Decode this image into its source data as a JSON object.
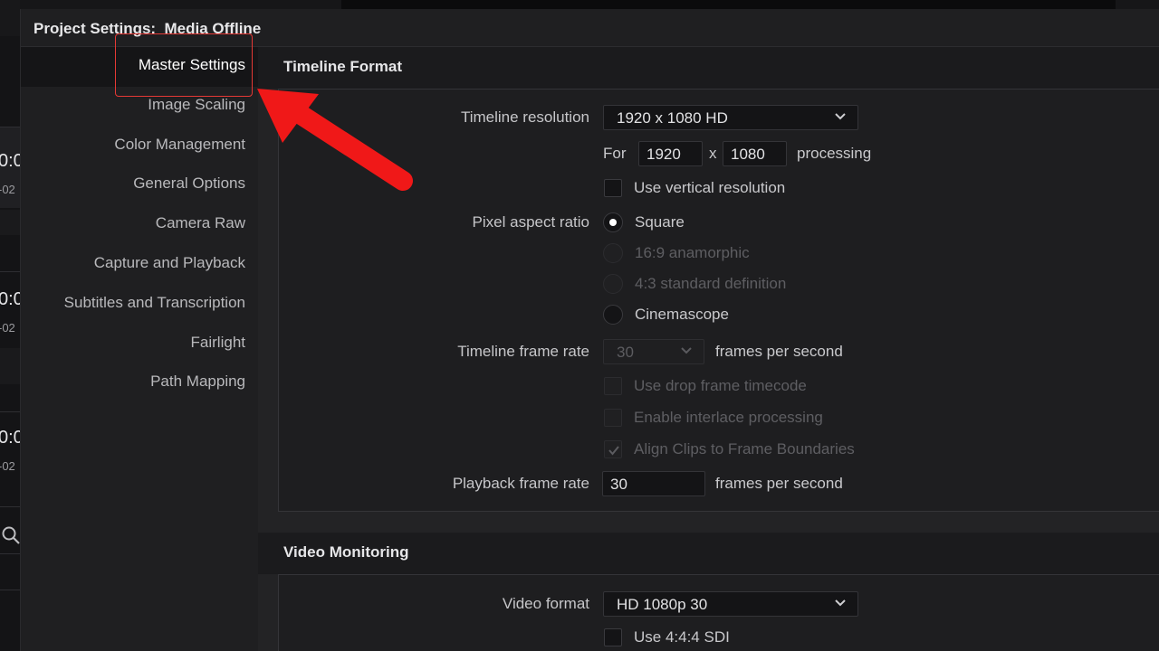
{
  "background": {
    "timecodes": [
      {
        "main": "0:0",
        "sub": "-02"
      },
      {
        "main": "0:0",
        "sub": "-02"
      },
      {
        "main": "0:0",
        "sub": "-02"
      }
    ]
  },
  "dialog": {
    "title": "Project Settings:  Media Offline"
  },
  "sidebar": {
    "items": [
      {
        "label": "Master Settings"
      },
      {
        "label": "Image Scaling"
      },
      {
        "label": "Color Management"
      },
      {
        "label": "General Options"
      },
      {
        "label": "Camera Raw"
      },
      {
        "label": "Capture and Playback"
      },
      {
        "label": "Subtitles and Transcription"
      },
      {
        "label": "Fairlight"
      },
      {
        "label": "Path Mapping"
      }
    ]
  },
  "timeline_format": {
    "heading": "Timeline Format",
    "resolution_label": "Timeline resolution",
    "resolution_value": "1920 x 1080 HD",
    "for_label": "For",
    "width": "1920",
    "x_label": "x",
    "height": "1080",
    "processing_label": "processing",
    "vertical_label": "Use vertical resolution",
    "pixel_aspect_label": "Pixel aspect ratio",
    "aspect_options": [
      "Square",
      "16:9 anamorphic",
      "4:3 standard definition",
      "Cinemascope"
    ],
    "frame_rate_label": "Timeline frame rate",
    "frame_rate_value": "30",
    "fps_label": "frames per second",
    "drop_frame_label": "Use drop frame timecode",
    "interlace_label": "Enable interlace processing",
    "align_clips_label": "Align Clips to Frame Boundaries",
    "playback_rate_label": "Playback frame rate",
    "playback_rate_value": "30",
    "playback_fps_label": "frames per second"
  },
  "video_monitoring": {
    "heading": "Video Monitoring",
    "video_format_label": "Video format",
    "video_format_value": "HD 1080p 30",
    "sdi_label": "Use 4:4:4 SDI"
  },
  "colors": {
    "accent_red": "#e53935",
    "annotation_arrow": "#f01818"
  }
}
